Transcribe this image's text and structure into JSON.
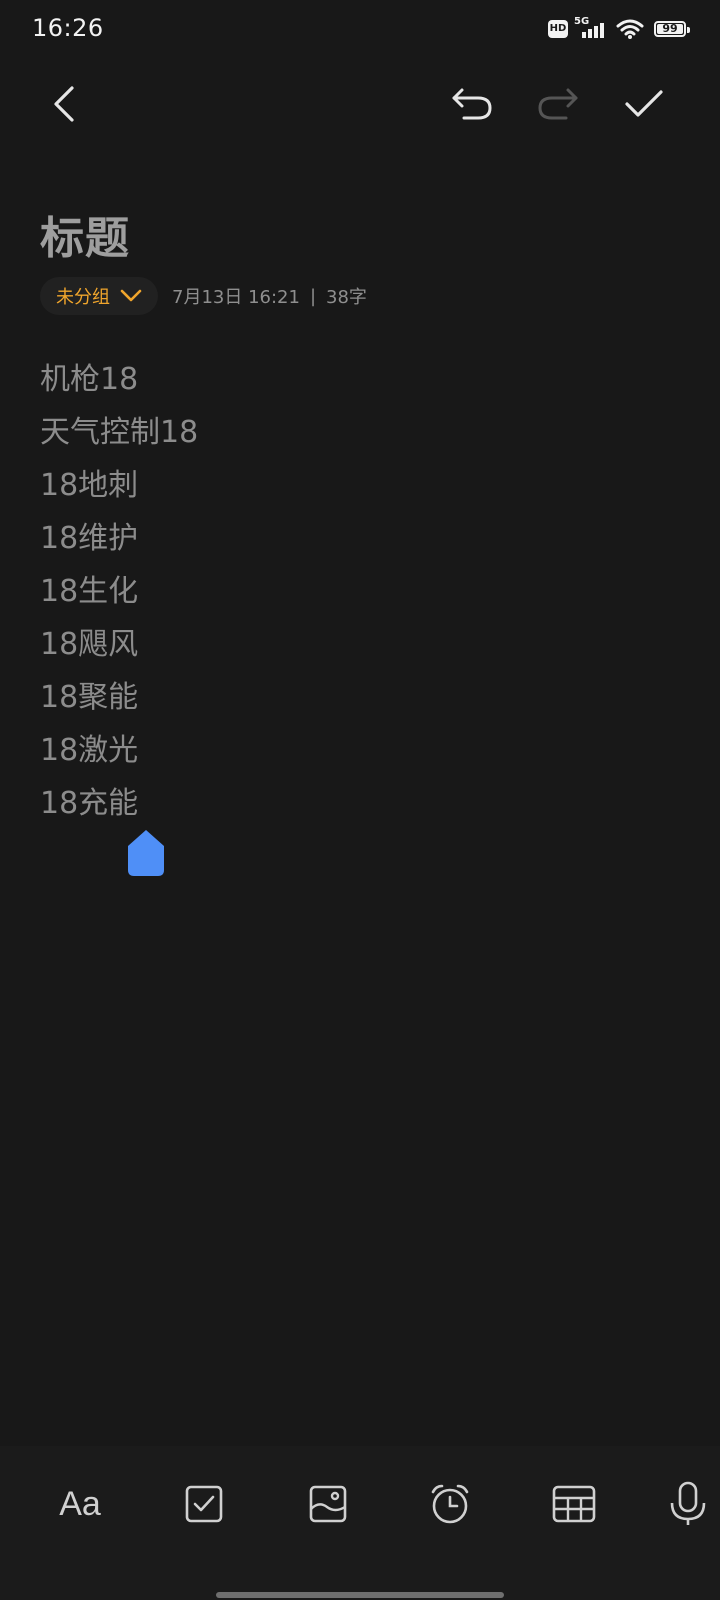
{
  "status_bar": {
    "time": "16:26",
    "network_badge": "HD",
    "network_type": "5G",
    "battery_level": "99"
  },
  "toolbar": {
    "back_icon": "chevron-left-icon",
    "undo_icon": "undo-icon",
    "redo_icon": "redo-icon",
    "confirm_icon": "check-icon",
    "redo_disabled": true
  },
  "note": {
    "title": "标题",
    "group_label": "未分组",
    "date": "7月13日 16:21",
    "separator": "|",
    "word_count": "38字",
    "lines": [
      "机枪18",
      "天气控制18",
      "18地刺",
      "18维护",
      "18生化",
      "18飓风",
      "18聚能",
      "18激光",
      "18充能"
    ]
  },
  "bottom_bar": {
    "font_label": "Aa",
    "items": [
      "font-icon",
      "checkbox-icon",
      "image-icon",
      "alarm-icon",
      "table-icon",
      "mic-icon"
    ]
  },
  "colors": {
    "background": "#181818",
    "accent_group": "#f0a52c",
    "cursor_handle": "#4f8ff7",
    "text_dim": "#8c8c8c"
  }
}
